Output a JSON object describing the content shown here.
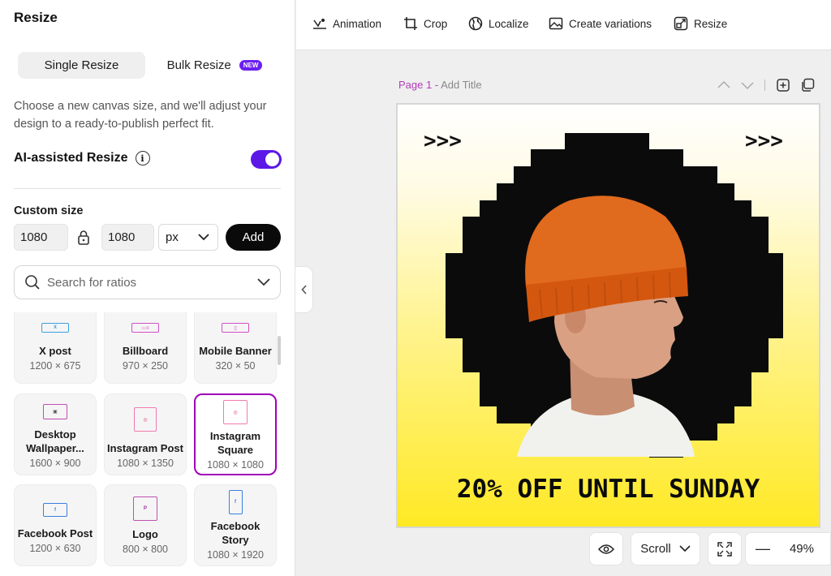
{
  "panel": {
    "title": "Resize",
    "tabs": {
      "single": "Single Resize",
      "bulk": "Bulk Resize",
      "new_badge": "NEW"
    },
    "description": "Choose a new canvas size, and we'll adjust your design to a ready-to-publish perfect fit.",
    "ai_resize": {
      "label": "AI-assisted Resize",
      "enabled": true
    },
    "custom_size": {
      "label": "Custom size",
      "width": "1080",
      "height": "1080",
      "unit": "px",
      "add_label": "Add"
    },
    "search": {
      "placeholder": "Search for ratios"
    },
    "tiles": [
      {
        "name": "X post",
        "dims": "1200 × 675",
        "icon": "x-logo-icon",
        "selected": false
      },
      {
        "name": "Billboard",
        "dims": "970 × 250",
        "icon": "billboard-icon",
        "selected": false
      },
      {
        "name": "Mobile Banner",
        "dims": "320 × 50",
        "icon": "mobile-banner-icon",
        "selected": false
      },
      {
        "name": "Desktop Wallpaper...",
        "dims": "1600 × 900",
        "icon": "image-icon",
        "selected": false
      },
      {
        "name": "Instagram Post",
        "dims": "1080 × 1350",
        "icon": "instagram-icon",
        "selected": false
      },
      {
        "name": "Instagram Square",
        "dims": "1080 × 1080",
        "icon": "instagram-icon",
        "selected": true
      },
      {
        "name": "Facebook Post",
        "dims": "1200 × 630",
        "icon": "facebook-icon",
        "selected": false
      },
      {
        "name": "Logo",
        "dims": "800 × 800",
        "icon": "logo-icon",
        "selected": false
      },
      {
        "name": "Facebook Story",
        "dims": "1080 × 1920",
        "icon": "facebook-icon",
        "selected": false
      }
    ]
  },
  "toolbar": {
    "animation": "Animation",
    "crop": "Crop",
    "localize": "Localize",
    "variations": "Create variations",
    "resize": "Resize"
  },
  "canvas": {
    "page_label": "Page 1 -",
    "page_title_placeholder": "Add Title",
    "promo_text": "20% OFF UNTIL SUNDAY",
    "arrows_text": ">>>"
  },
  "bottom": {
    "scroll_label": "Scroll",
    "zoom": "49%"
  },
  "colors": {
    "accent_purple": "#5b18e6",
    "selected_border": "#a000b8",
    "poster_yellow": "#ffe925",
    "black": "#0a0a0a"
  }
}
